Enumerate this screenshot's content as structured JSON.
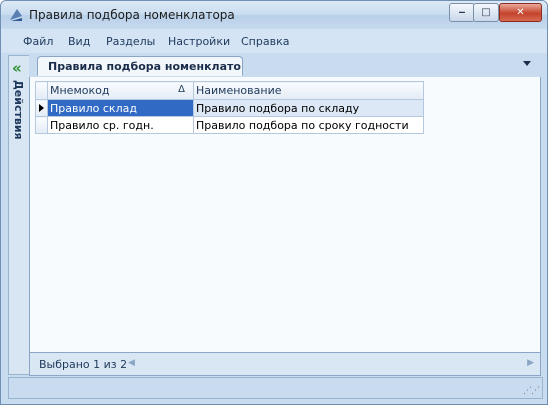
{
  "window": {
    "title": "Правила подбора номенклатора",
    "minimize": "‒",
    "maximize": "□",
    "close": "✕"
  },
  "menu": [
    "Файл",
    "Вид",
    "Разделы",
    "Настройки",
    "Справка"
  ],
  "sidebar": {
    "label": "Действия"
  },
  "tab": {
    "label": "Правила подбора номенклато..."
  },
  "grid": {
    "columns": [
      "Мнемокод",
      "Наименование"
    ],
    "sort_indicator": "Δ",
    "rows": [
      {
        "code": "Правило склад",
        "name": "Правило подбора по складу",
        "selected": true
      },
      {
        "code": "Правило ср. годн.",
        "name": "Правило подбора по сроку годности",
        "selected": false
      }
    ]
  },
  "status": {
    "text": "Выбрано 1 из 2"
  },
  "colors": {
    "selection": "#316ac5",
    "accent": "#1e395b",
    "close_button": "#c5432c"
  }
}
